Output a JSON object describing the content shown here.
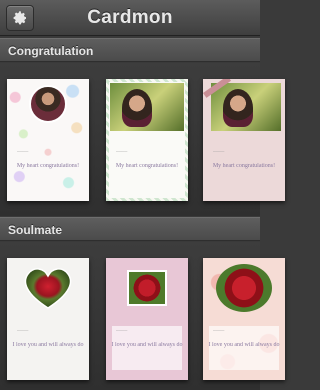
{
  "header": {
    "title": "Cardmon",
    "settings_icon": "gear-icon"
  },
  "sections": [
    {
      "title": "Congratulation",
      "cards": [
        {
          "message": "My heart congratulations!",
          "style": "dots"
        },
        {
          "message": "My heart congratulations!",
          "style": "chevron"
        },
        {
          "message": "My heart congratulations!",
          "style": "pink"
        }
      ]
    },
    {
      "title": "Soulmate",
      "cards": [
        {
          "message": "I love you and will always do",
          "style": "heart"
        },
        {
          "message": "I love you and will always do",
          "style": "lilac"
        },
        {
          "message": "I love you and will always do",
          "style": "floral"
        }
      ]
    }
  ]
}
